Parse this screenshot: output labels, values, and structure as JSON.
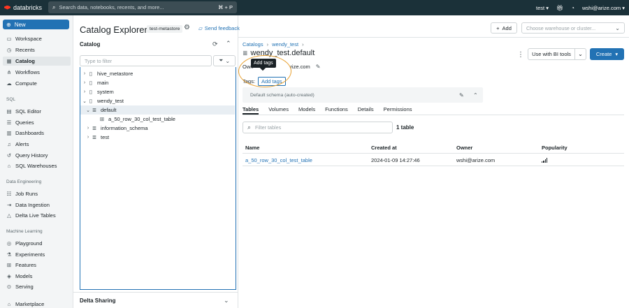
{
  "topbar": {
    "brand": "databricks",
    "search_placeholder": "Search data, notebooks, recents, and more...",
    "shortcut": "⌘ + P",
    "workspace": "test",
    "user": "wshi@arize.com"
  },
  "sidenav": {
    "new_label": "New",
    "items_main": [
      "Workspace",
      "Recents",
      "Catalog",
      "Workflows",
      "Compute"
    ],
    "section_sql": "SQL",
    "items_sql": [
      "SQL Editor",
      "Queries",
      "Dashboards",
      "Alerts",
      "Query History",
      "SQL Warehouses"
    ],
    "section_de": "Data Engineering",
    "items_de": [
      "Job Runs",
      "Data Ingestion",
      "Delta Live Tables"
    ],
    "section_ml": "Machine Learning",
    "items_ml": [
      "Playground",
      "Experiments",
      "Features",
      "Models",
      "Serving"
    ],
    "marketplace": "Marketplace"
  },
  "catalog_panel": {
    "title": "Catalog Explorer",
    "metastore": "test-metastore",
    "feedback": "Send feedback",
    "catalog_label": "Catalog",
    "filter_placeholder": "Type to filter",
    "tree": [
      "hive_metastore",
      "main",
      "system",
      "wendy_test",
      "default",
      "a_50_row_30_col_test_table",
      "information_schema",
      "test"
    ],
    "delta_sharing": "Delta Sharing"
  },
  "main": {
    "add_label": "Add",
    "warehouse_placeholder": "Choose warehouse or cluster...",
    "breadcrumbs": [
      "Catalogs",
      "wendy_test"
    ],
    "schema_name": "wendy_test.default",
    "bi_label": "Use with BI tools",
    "create_label": "Create",
    "owner_prefix": "Own",
    "owner_rest": "rize.com",
    "tooltip": "Add tags",
    "tags_label": "Tags:",
    "add_tags": "Add tags",
    "comment": "Default schema (auto-created)",
    "tabs": [
      "Tables",
      "Volumes",
      "Models",
      "Functions",
      "Details",
      "Permissions"
    ],
    "filter_tables_placeholder": "Filter tables",
    "table_count": "1 table",
    "columns": [
      "Name",
      "Created at",
      "Owner",
      "Popularity"
    ],
    "rows": [
      {
        "name": "a_50_row_30_col_test_table",
        "created": "2024-01-09 14:27:46",
        "owner": "wshi@arize.com"
      }
    ]
  }
}
